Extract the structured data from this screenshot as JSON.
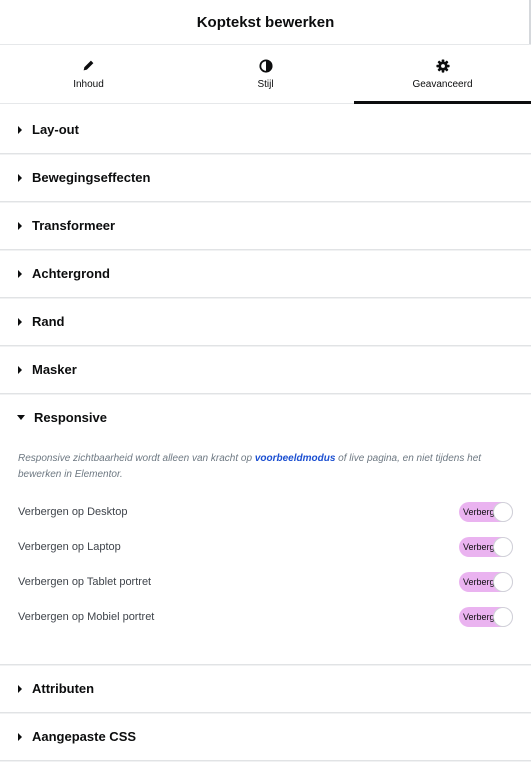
{
  "header": {
    "title": "Koptekst bewerken"
  },
  "tabs": [
    {
      "label": "Inhoud",
      "icon": "pencil-icon"
    },
    {
      "label": "Stijl",
      "icon": "half-circle-icon"
    },
    {
      "label": "Geavanceerd",
      "icon": "gear-icon",
      "active": true
    }
  ],
  "sections": {
    "layout": "Lay-out",
    "motion": "Bewegingseffecten",
    "transform": "Transformeer",
    "background": "Achtergrond",
    "border": "Rand",
    "mask": "Masker",
    "responsive": "Responsive",
    "attributes": "Attributen",
    "custom_css": "Aangepaste CSS"
  },
  "responsive": {
    "note_before": "Responsive zichtbaarheid wordt alleen van kracht op ",
    "note_link": "voorbeeldmodus",
    "note_after": " of live pagina, en niet tijdens het bewerken in Elementor.",
    "rows": [
      {
        "label": "Verbergen op Desktop",
        "toggle": "Verbergen"
      },
      {
        "label": "Verbergen op Laptop",
        "toggle": "Verbergen"
      },
      {
        "label": "Verbergen op Tablet portret",
        "toggle": "Verbergen"
      },
      {
        "label": "Verbergen op Mobiel portret",
        "toggle": "Verbergen"
      }
    ]
  },
  "colors": {
    "accent": "#0c0d0e",
    "toggle_bg": "#eab3f0",
    "link": "#1b4fd1"
  }
}
